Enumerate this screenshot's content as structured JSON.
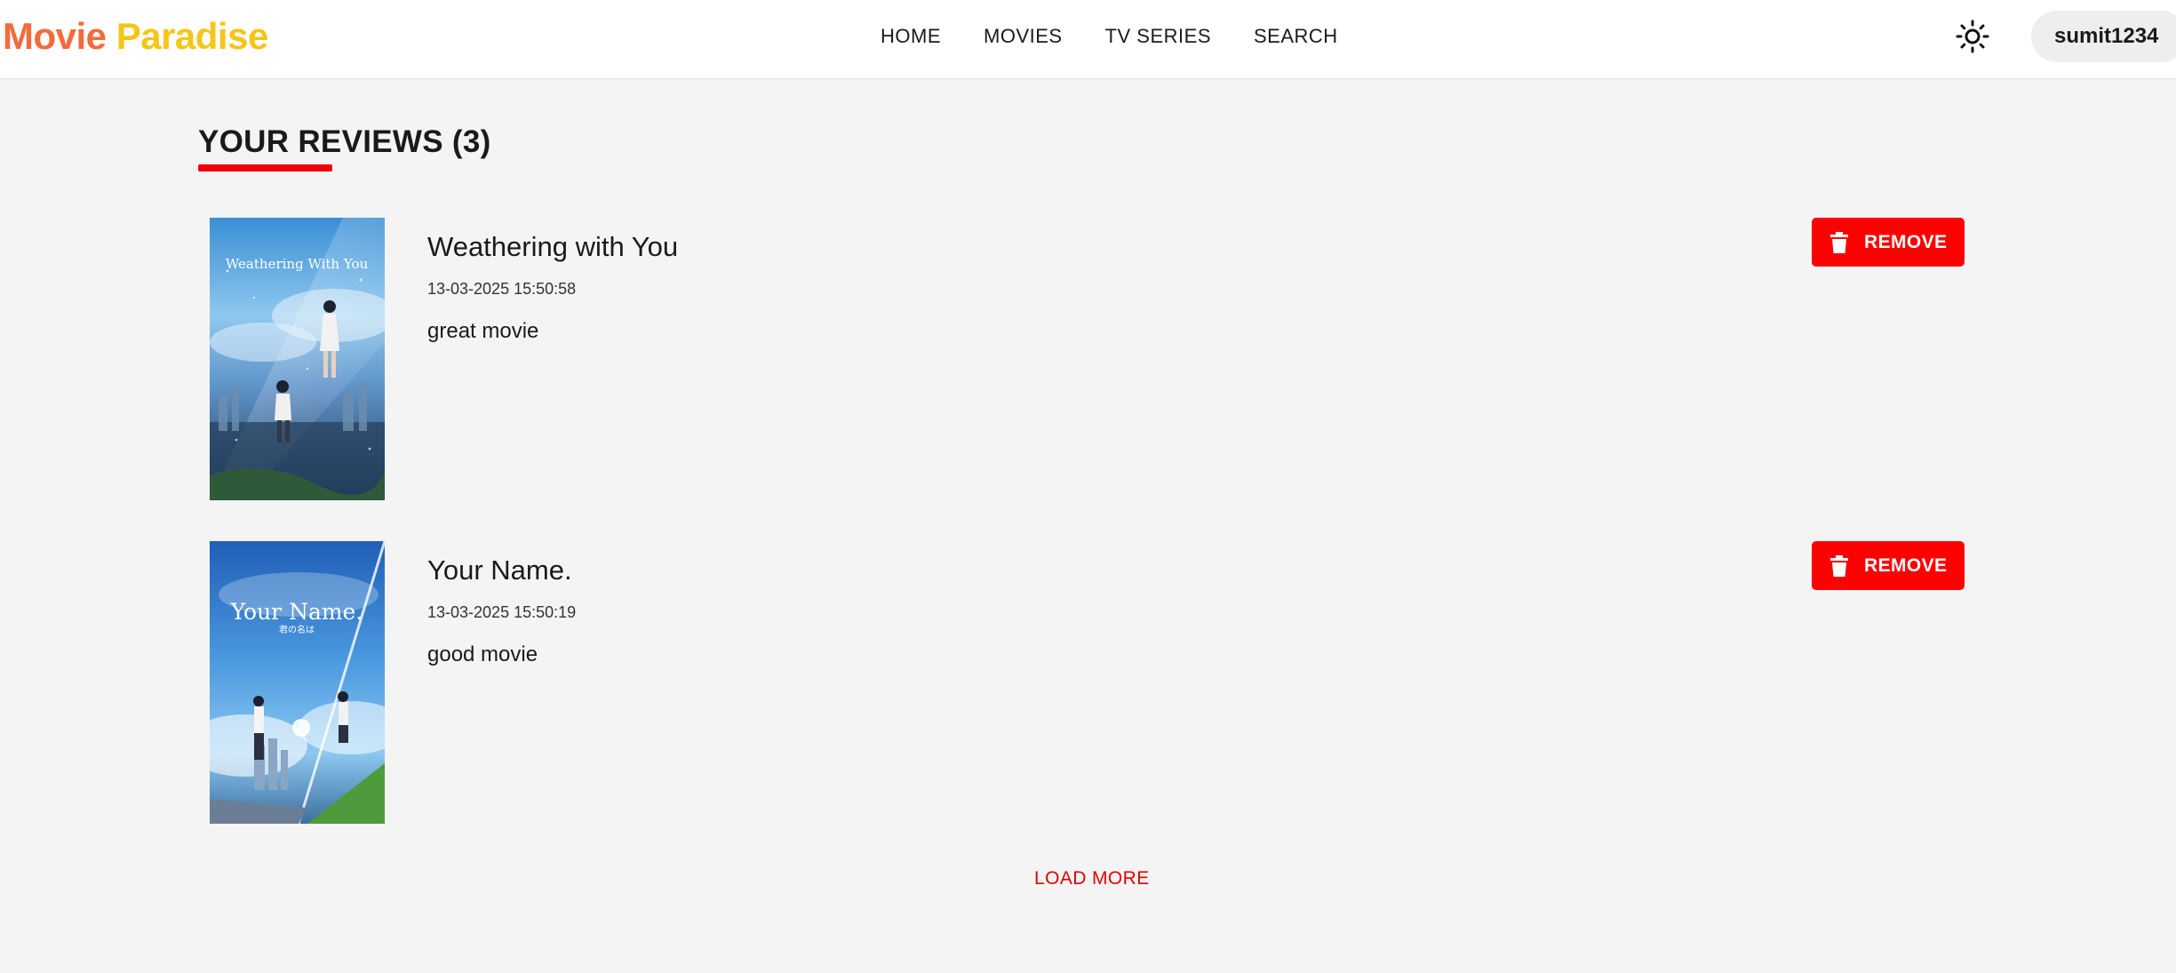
{
  "header": {
    "logo_word1": "Movie",
    "logo_word2": "Paradise",
    "nav": [
      "HOME",
      "MOVIES",
      "TV SERIES",
      "SEARCH"
    ],
    "theme_icon": "sun-icon",
    "username": "sumit1234"
  },
  "main": {
    "section_title": "YOUR REVIEWS (3)",
    "reviews": [
      {
        "title": "Weathering with You",
        "date": "13-03-2025 15:50:58",
        "text": "great movie",
        "poster_caption": "Weathering With You",
        "remove_label": "REMOVE"
      },
      {
        "title": "Your Name.",
        "date": "13-03-2025 15:50:19",
        "text": "good movie",
        "poster_caption": "Your Name.",
        "poster_subcaption": "君の名は",
        "remove_label": "REMOVE"
      }
    ],
    "load_more_label": "LOAD MORE"
  },
  "colors": {
    "accent": "#ff0000",
    "logo_orange": "#f26b3a",
    "logo_yellow": "#f5c518",
    "background": "#f4f4f4"
  }
}
